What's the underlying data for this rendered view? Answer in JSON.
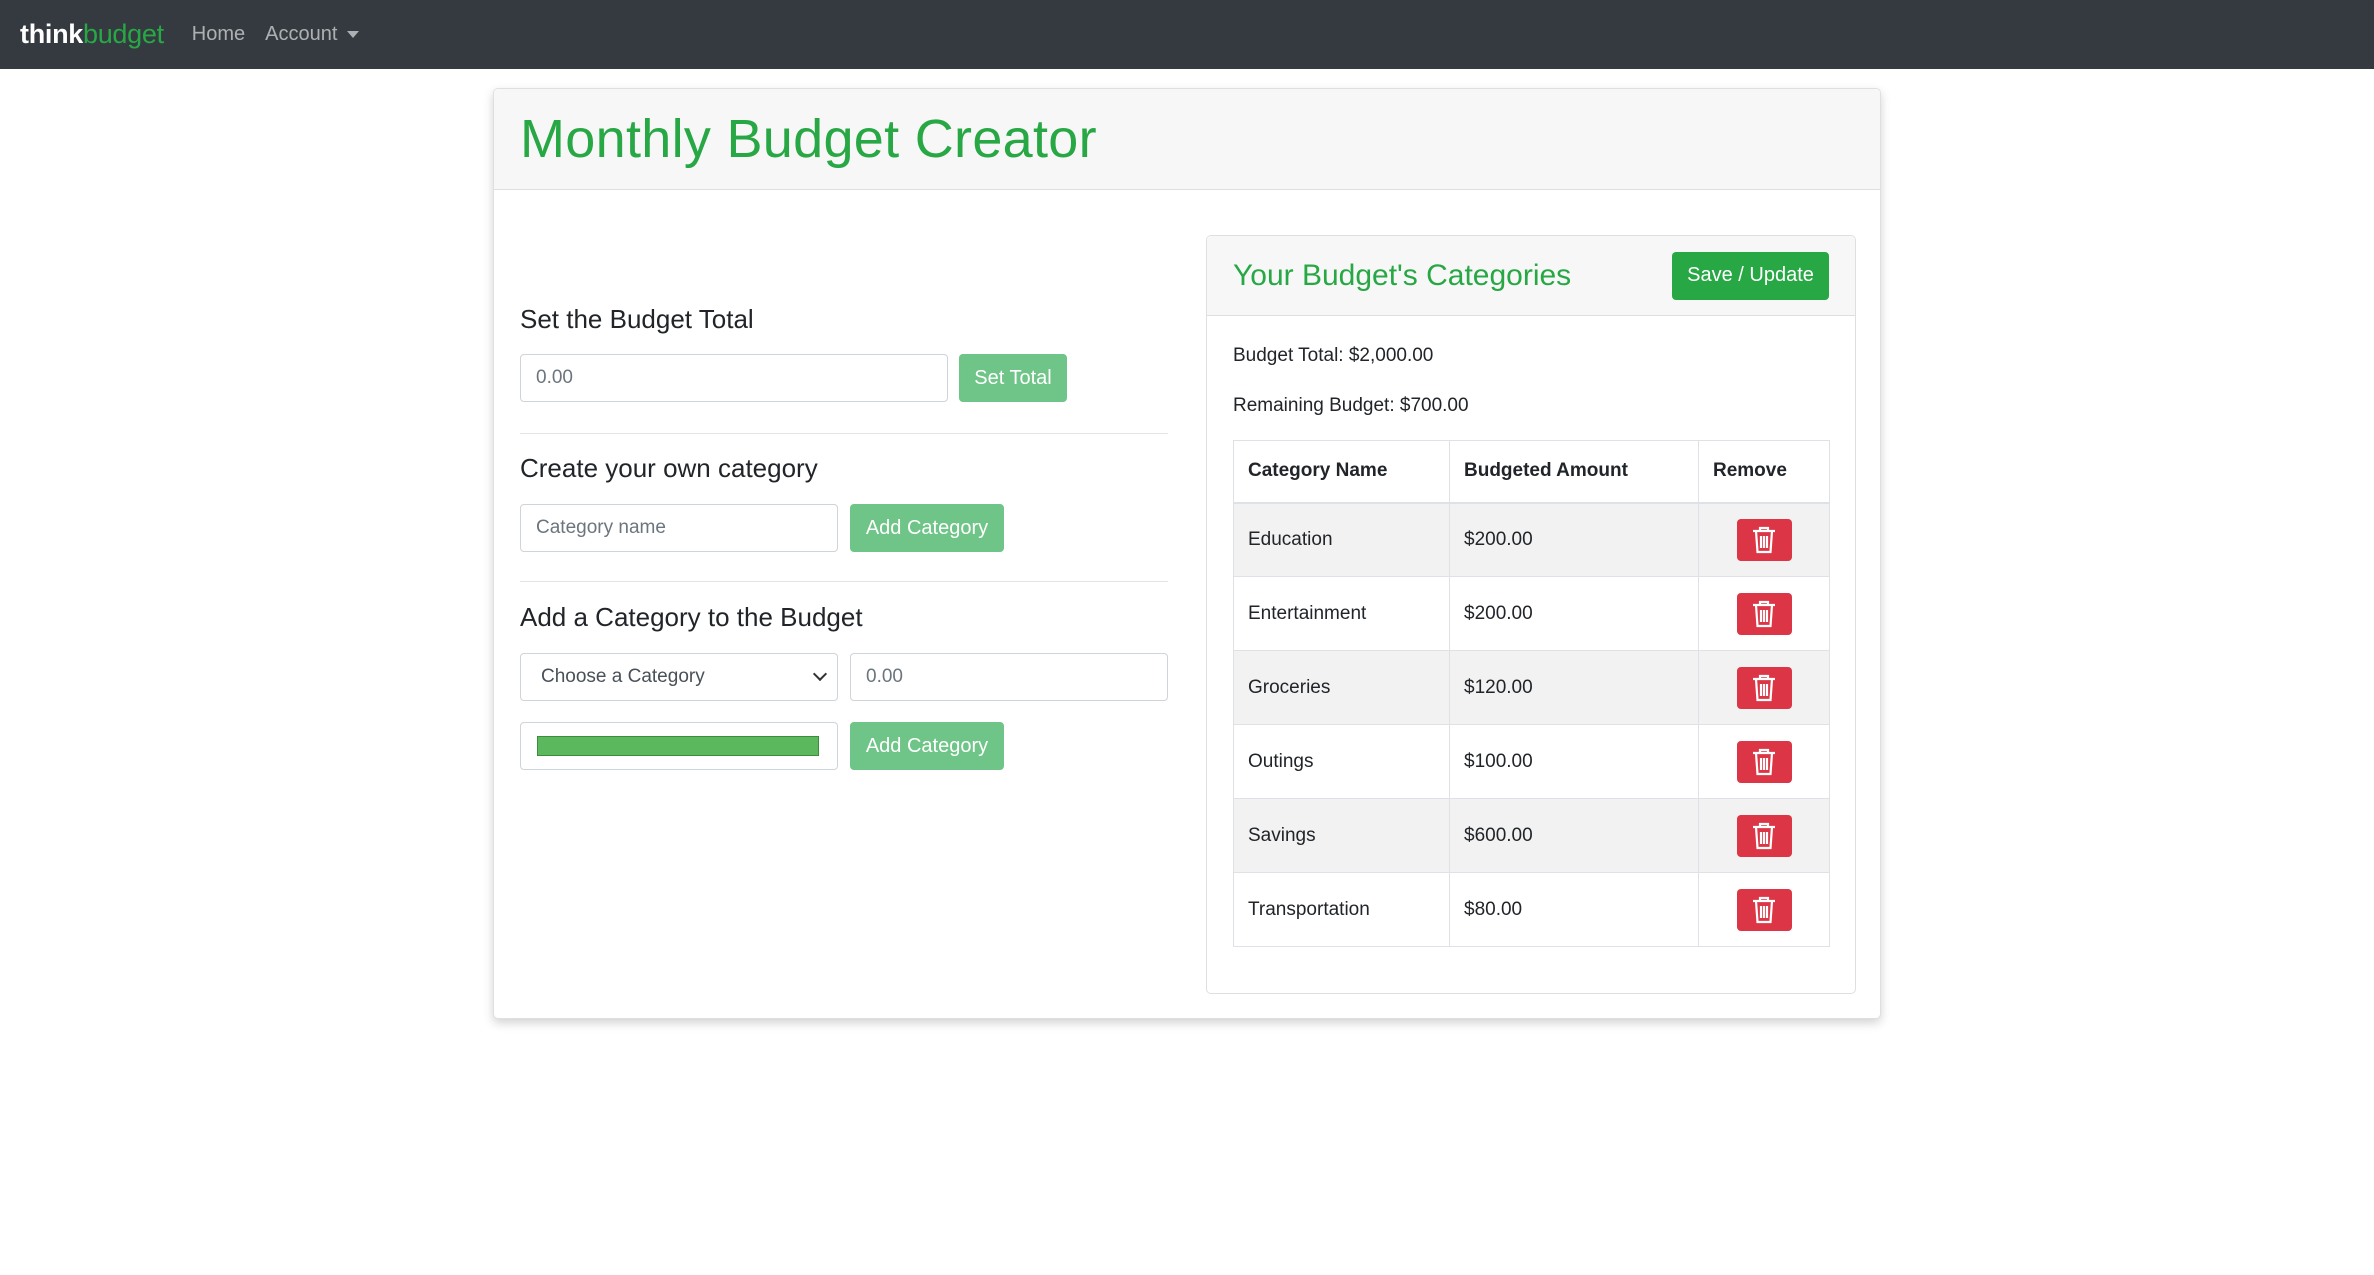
{
  "navbar": {
    "brand_part1": "think",
    "brand_part2": "budget",
    "home": "Home",
    "account": "Account"
  },
  "main": {
    "title": "Monthly Budget Creator"
  },
  "set_total": {
    "title": "Set the Budget Total",
    "input_placeholder": "0.00",
    "button": "Set Total"
  },
  "create_category": {
    "title": "Create your own category",
    "input_placeholder": "Category name",
    "button": "Add Category"
  },
  "add_to_budget": {
    "title": "Add a Category to the Budget",
    "select_value": "Choose a Category",
    "amount_placeholder": "0.00",
    "color_value": "#5cb85c",
    "button": "Add Category"
  },
  "categories_panel": {
    "title": "Your Budget's Categories",
    "save_button": "Save / Update",
    "budget_total": "Budget Total: $2,000.00",
    "remaining": "Remaining Budget: $700.00",
    "columns": [
      "Category Name",
      "Budgeted Amount",
      "Remove"
    ],
    "rows": [
      {
        "name": "Education",
        "amount": "$200.00"
      },
      {
        "name": "Entertainment",
        "amount": "$200.00"
      },
      {
        "name": "Groceries",
        "amount": "$120.00"
      },
      {
        "name": "Outings",
        "amount": "$100.00"
      },
      {
        "name": "Savings",
        "amount": "$600.00"
      },
      {
        "name": "Transportation",
        "amount": "$80.00"
      }
    ],
    "remove_icon": "trash-icon"
  },
  "colors": {
    "accent": "#28a745",
    "navbar": "#343a40",
    "danger": "#dc3545",
    "button_light_green": "#6fc487"
  }
}
